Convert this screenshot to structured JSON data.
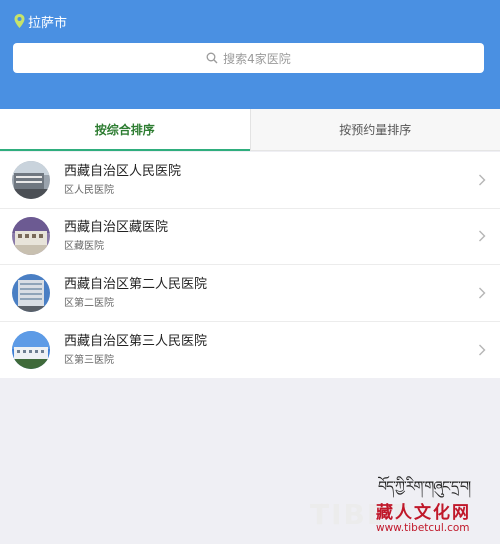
{
  "header": {
    "city": "拉萨市",
    "search_placeholder": "搜索4家医院"
  },
  "tabs": [
    {
      "label": "按综合排序",
      "active": true
    },
    {
      "label": "按预约量排序",
      "active": false
    }
  ],
  "hospitals": [
    {
      "name": "西藏自治区人民医院",
      "short": "区人民医院"
    },
    {
      "name": "西藏自治区藏医院",
      "short": "区藏医院"
    },
    {
      "name": "西藏自治区第二人民医院",
      "short": "区第二医院"
    },
    {
      "name": "西藏自治区第三人民医院",
      "short": "区第三医院"
    }
  ],
  "watermark": {
    "tibetan": "བོད་ཀྱི་རིག་གཞུང་དྲ་བ།",
    "latin": "TIBET",
    "chinese": "藏人文化网",
    "url": "www.tibetcul.com"
  },
  "colors": {
    "header_bg": "#4a90e2",
    "active_tab": "#2e7d32",
    "accent_line": "#2fae7d",
    "watermark_red": "#c0182a"
  }
}
